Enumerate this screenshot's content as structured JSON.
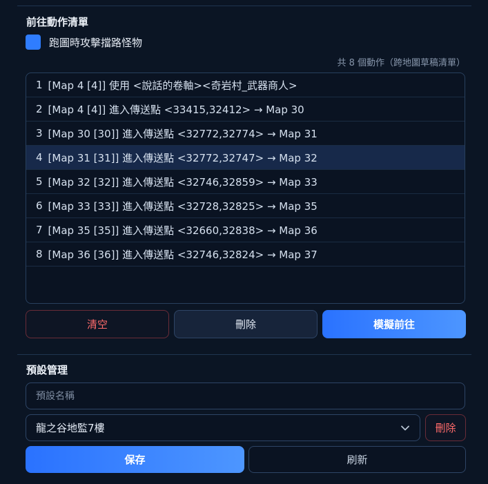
{
  "action_list": {
    "title": "前往動作清單",
    "attack_checkbox": {
      "label": "跑圖時攻擊擋路怪物",
      "checked": true
    },
    "count_text": "共 8 個動作（跨地圖草稿清單）",
    "items": [
      {
        "num": "1",
        "text": "[Map 4 [4]]  使用 <說話的卷軸><奇岩村_武器商人>"
      },
      {
        "num": "2",
        "text": "[Map 4 [4]]  進入傳送點 <33415,32412> → Map 30"
      },
      {
        "num": "3",
        "text": "[Map 30 [30]]  進入傳送點 <32772,32774> → Map 31"
      },
      {
        "num": "4",
        "text": "[Map 31 [31]]  進入傳送點 <32772,32747> → Map 32"
      },
      {
        "num": "5",
        "text": "[Map 32 [32]]  進入傳送點 <32746,32859> → Map 33"
      },
      {
        "num": "6",
        "text": "[Map 33 [33]]  進入傳送點 <32728,32825> → Map 35"
      },
      {
        "num": "7",
        "text": "[Map 35 [35]]  進入傳送點 <32660,32838> → Map 36"
      },
      {
        "num": "8",
        "text": "[Map 36 [36]]  進入傳送點 <32746,32824> → Map 37"
      }
    ],
    "selected_index": 4,
    "buttons": {
      "clear": "清空",
      "delete": "刪除",
      "simulate": "模擬前往"
    }
  },
  "preset": {
    "title": "預設管理",
    "name_placeholder": "預設名稱",
    "selected": "龍之谷地監7樓",
    "delete_label": "刪除",
    "save_label": "保存",
    "refresh_label": "刷新"
  },
  "colors": {
    "accent": "#2f7dff",
    "danger": "#ff6b6b",
    "background": "#0b1524"
  }
}
